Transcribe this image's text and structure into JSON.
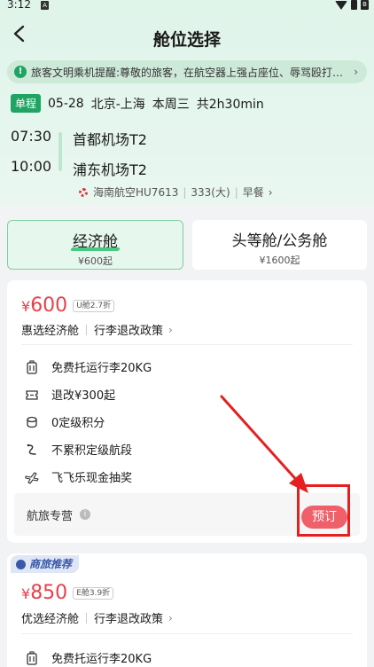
{
  "status_bar": {
    "time": "3:12",
    "notification_icon": "A",
    "battery_badge": "B"
  },
  "nav": {
    "title": "舱位选择"
  },
  "notice": {
    "text": "旅客文明乘机提醒:尊敬的旅客，在航空器上强占座位、辱骂殴打工作人员等行为"
  },
  "trip": {
    "tag": "单程",
    "date": "05-28",
    "route": "北京-上海",
    "weekday": "本周三",
    "duration": "共2h30min",
    "dep_time": "07:30",
    "arr_time": "10:00",
    "dep_airport": "首都机场T2",
    "arr_airport": "浦东机场T2",
    "flight": "海南航空HU7613",
    "aircraft": "333(大)",
    "meal": "早餐",
    "chevron": "›"
  },
  "cabin_tabs": [
    {
      "name": "经济舱",
      "price": "¥600起",
      "active": true
    },
    {
      "name": "头等舱/公务舱",
      "price": "¥1600起",
      "active": false
    }
  ],
  "fares": [
    {
      "yen": "¥",
      "price": "600",
      "discount": "U舱2.7折",
      "name": "惠选经济舱",
      "policy": "行李退改政策",
      "chevron": "›",
      "benefits": [
        "免费托运行李20KG",
        "退改¥300起",
        "0定级积分",
        "不累积定级航段",
        "飞飞乐现金抽奖"
      ],
      "seller": "航旅专营",
      "seller_help": "i",
      "book_label": "预订"
    },
    {
      "badge": "商旅推荐",
      "yen": "¥",
      "price": "850",
      "discount": "E舱3.9折",
      "name": "优选经济舱",
      "policy": "行李退改政策",
      "chevron": "›",
      "benefits": [
        "免费托运行李20KG"
      ]
    }
  ],
  "colors": {
    "accent_green": "#1fa463",
    "price_red": "#e8404a",
    "book_button": "#f0606a",
    "highlight_box": "#e62020"
  },
  "icons": [
    "back-icon",
    "info-icon",
    "luggage-icon",
    "refund-ticket-icon",
    "points-coin-icon",
    "segment-route-icon",
    "lottery-plane-icon"
  ]
}
